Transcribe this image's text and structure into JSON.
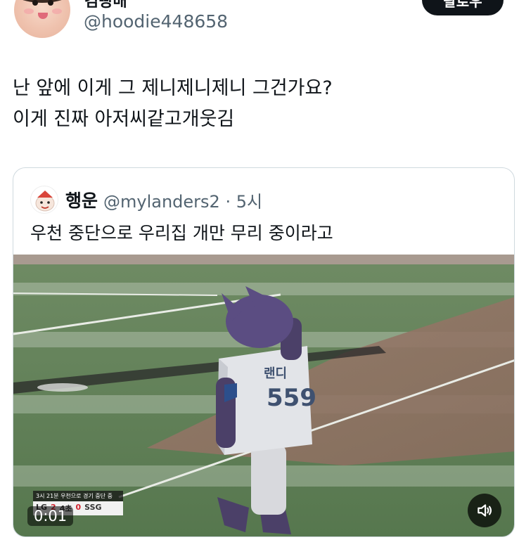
{
  "header": {
    "display_name": "김빵배",
    "handle": "@hoodie448658",
    "follow_label": "팔로우"
  },
  "tweet": {
    "lines": [
      "난 앞에 이게 그 제니제니제니 그건가요?",
      "이게 진짜 아저씨같고개웃김"
    ]
  },
  "quote": {
    "name": "행운",
    "meta": "@mylanders2 · 5시",
    "text": "우천 중단으로 우리집 개만 무리 중이라고",
    "video": {
      "timer": "0:01",
      "scorebug": {
        "top_text": "3시 21분 우천으로 경기 중단 중",
        "team1": "LG",
        "team1_score": "2",
        "inning": "4초",
        "team2_score": "0",
        "team2": "SSG"
      },
      "jersey_name": "랜디",
      "jersey_number": "559"
    }
  },
  "icons": {
    "sound": "speaker-icon"
  },
  "colors": {
    "text": "#0f1419",
    "secondary": "#536471",
    "border": "#cfd9de",
    "mascot_purple": "#5b4d82"
  }
}
